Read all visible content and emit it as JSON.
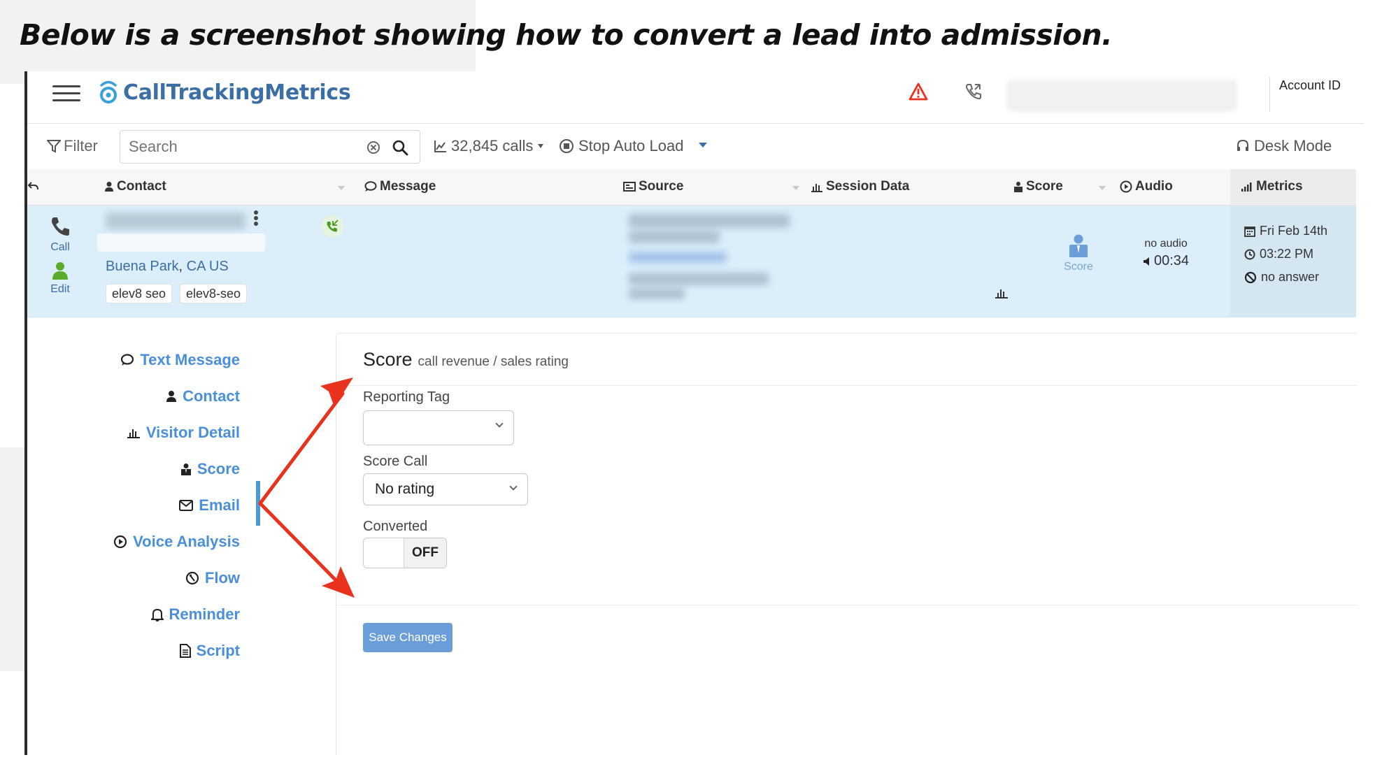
{
  "headline": "Below is a screenshot showing how to convert a lead into admission.",
  "nav": {
    "logo_text": "CallTrackingMetrics",
    "account_label": "Account ID"
  },
  "toolbar": {
    "filter_label": "Filter",
    "search_placeholder": "Search",
    "calls_count": "32,845 calls",
    "stop_auto_load": "Stop Auto Load",
    "desk_mode": "Desk Mode"
  },
  "columns": {
    "contact": "Contact",
    "message": "Message",
    "source": "Source",
    "session_data": "Session Data",
    "score": "Score",
    "audio": "Audio",
    "metrics": "Metrics"
  },
  "call_row": {
    "call_label": "Call",
    "edit_label": "Edit",
    "city": "Buena Park",
    "region": "CA US",
    "tags": [
      "elev8 seo",
      "elev8-seo"
    ],
    "score_label": "Score",
    "audio_status": "no audio",
    "duration": "00:34",
    "date": "Fri Feb 14th",
    "time": "03:22 PM",
    "outcome": "no answer"
  },
  "side_nav": {
    "items": [
      {
        "label": "Text Message",
        "icon": "speech-bubble-icon"
      },
      {
        "label": "Contact",
        "icon": "user-icon"
      },
      {
        "label": "Visitor Detail",
        "icon": "bar-chart-icon"
      },
      {
        "label": "Score",
        "icon": "score-icon"
      },
      {
        "label": "Email",
        "icon": "envelope-icon"
      },
      {
        "label": "Voice Analysis",
        "icon": "play-circle-icon"
      },
      {
        "label": "Flow",
        "icon": "flow-icon"
      },
      {
        "label": "Reminder",
        "icon": "bell-icon"
      },
      {
        "label": "Script",
        "icon": "document-icon"
      }
    ],
    "active": "Score"
  },
  "score_panel": {
    "title": "Score",
    "subtitle": "call revenue / sales rating",
    "reporting_tag_label": "Reporting Tag",
    "reporting_tag_value": "",
    "score_call_label": "Score Call",
    "score_call_value": "No rating",
    "converted_label": "Converted",
    "converted_state": "OFF",
    "save_label": "Save Changes"
  },
  "colors": {
    "brand_blue": "#3b6ea5",
    "link_blue": "#4a8fd8",
    "row_highlight": "#dbeefa",
    "annotation_red": "#e8321e",
    "save_button": "#6b9ed8"
  }
}
